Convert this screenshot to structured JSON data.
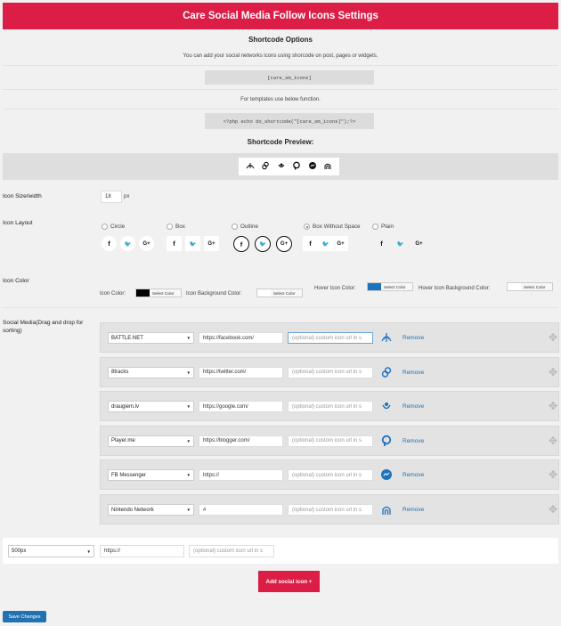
{
  "header": {
    "title": "Care Social Media Follow Icons Settings"
  },
  "shortcode": {
    "title": "Shortcode Options",
    "desc": "You can add your social networks icons using shorcode on post, pages or widgets.",
    "code": "[care_sm_icons]",
    "template_desc": "For templates use below function.",
    "php": "<?php echo do_shortcode(\"[care_sm_icons]\");?>",
    "preview_title": "Shortcode Preview:"
  },
  "icon_size": {
    "label": "Icon Size/width",
    "value": "18",
    "unit": "px"
  },
  "icon_layout": {
    "label": "Icon Layout",
    "options": [
      {
        "label": "Circle",
        "checked": false
      },
      {
        "label": "Box",
        "checked": false
      },
      {
        "label": "Outline",
        "checked": false
      },
      {
        "label": "Box Without Space",
        "checked": true
      },
      {
        "label": "Plain",
        "checked": false
      }
    ],
    "glyphs": {
      "facebook": "f",
      "twitter": "🐦",
      "google": "G+"
    }
  },
  "icon_color": {
    "label": "Icon Color",
    "icon_color_label": "Icon Color:",
    "icon_bg_label": "Icon Background Color:",
    "hover_label": "Hover Icon Color:",
    "hover_bg_label": "Hover Icon Background Color:",
    "select_label": "Select Color",
    "icon_color_value": "#000000",
    "icon_bg_value": "#ffffff",
    "hover_value": "#1e73be",
    "hover_bg_value": "#ffffff"
  },
  "social_media": {
    "label": "Social Media(Drag and drop for sorting)",
    "custom_placeholder": "(optional) custom icon url in s",
    "remove_label": "Remove",
    "rows": [
      {
        "network": "BATTLE.NET",
        "url": "https://facebook.com/",
        "icon": "battlenet-icon"
      },
      {
        "network": "8tracks",
        "url": "https://twitter.com/",
        "icon": "8tracks-icon"
      },
      {
        "network": "draugiem.lv",
        "url": "https://google.com/",
        "icon": "draugiem-icon"
      },
      {
        "network": "Player.me",
        "url": "https://blogger.com/",
        "icon": "playerme-icon"
      },
      {
        "network": "FB Messenger",
        "url": "https://",
        "icon": "messenger-icon"
      },
      {
        "network": "Nintendo Network",
        "url": "#",
        "icon": "nintendo-icon"
      }
    ]
  },
  "new_row": {
    "size": "500px",
    "url": "https://",
    "placeholder": "(optional) custom icon url in s"
  },
  "buttons": {
    "add": "Add social icon +",
    "save": "Save Changes"
  },
  "colors": {
    "brand": "#dc1d46",
    "link": "#2271b1"
  }
}
